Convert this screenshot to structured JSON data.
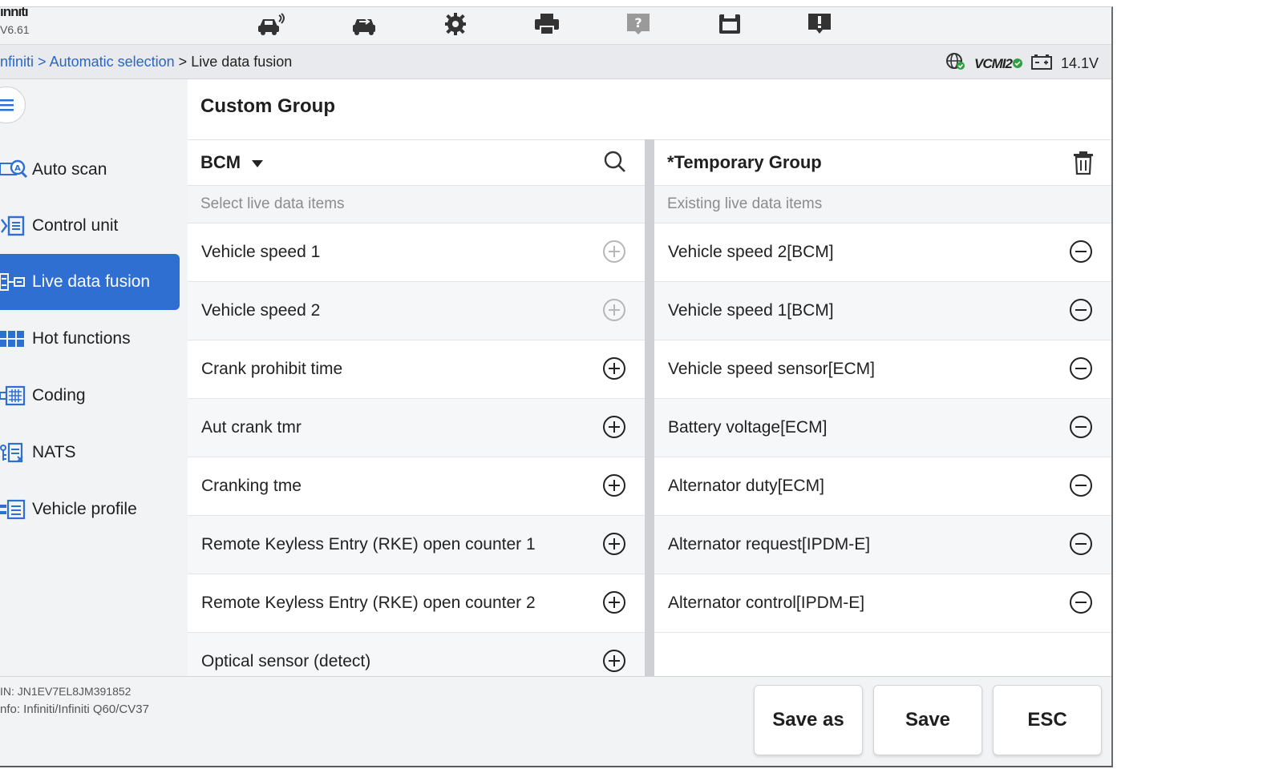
{
  "header": {
    "brand": "ınnıtı",
    "version": "V6.61"
  },
  "toolbar": {
    "tools": [
      "car-scan-icon",
      "swap-car-icon",
      "settings-icon",
      "print-icon",
      "help-icon",
      "save-icon",
      "alert-icon"
    ]
  },
  "breadcrumb": {
    "parts": [
      "nfiniti",
      "Automatic selection",
      "Live data fusion"
    ],
    "separator": ">"
  },
  "status": {
    "vcmi": "VCMI2",
    "voltage": "14.1V"
  },
  "sidebar": {
    "items": [
      {
        "label": "Auto scan",
        "icon": "auto-scan-icon"
      },
      {
        "label": "Control unit",
        "icon": "control-unit-icon"
      },
      {
        "label": "Live data fusion",
        "icon": "live-data-icon",
        "active": true
      },
      {
        "label": "Hot functions",
        "icon": "hot-functions-icon"
      },
      {
        "label": "Coding",
        "icon": "coding-icon"
      },
      {
        "label": "NATS",
        "icon": "nats-icon"
      },
      {
        "label": "Vehicle profile",
        "icon": "vehicle-profile-icon"
      }
    ]
  },
  "main": {
    "title": "Custom Group",
    "left": {
      "module": "BCM",
      "subheader": "Select live data items",
      "items": [
        {
          "label": "Vehicle speed 1",
          "added": true
        },
        {
          "label": "Vehicle speed 2",
          "added": true
        },
        {
          "label": "Crank prohibit time",
          "added": false
        },
        {
          "label": "Aut crank tmr",
          "added": false
        },
        {
          "label": "Cranking tme",
          "added": false
        },
        {
          "label": "Remote Keyless Entry (RKE) open counter 1",
          "added": false
        },
        {
          "label": "Remote Keyless Entry (RKE) open counter 2",
          "added": false
        },
        {
          "label": "Optical sensor (detect)",
          "added": false
        }
      ]
    },
    "right": {
      "title": "*Temporary Group",
      "subheader": "Existing live data items",
      "items": [
        "Vehicle speed 2[BCM]",
        "Vehicle speed 1[BCM]",
        "Vehicle speed sensor[ECM]",
        "Battery voltage[ECM]",
        "Alternator duty[ECM]",
        "Alternator request[IPDM-E]",
        "Alternator control[IPDM-E]"
      ]
    }
  },
  "footer": {
    "vin": "IN: JN1EV7EL8JM391852",
    "info": "nfo: Infiniti/Infiniti Q60/CV37",
    "buttons": [
      "Save as",
      "Save",
      "ESC"
    ]
  },
  "colors": {
    "accent": "#2e6fd1",
    "link": "#2a66c9",
    "ok": "#2ea043"
  }
}
